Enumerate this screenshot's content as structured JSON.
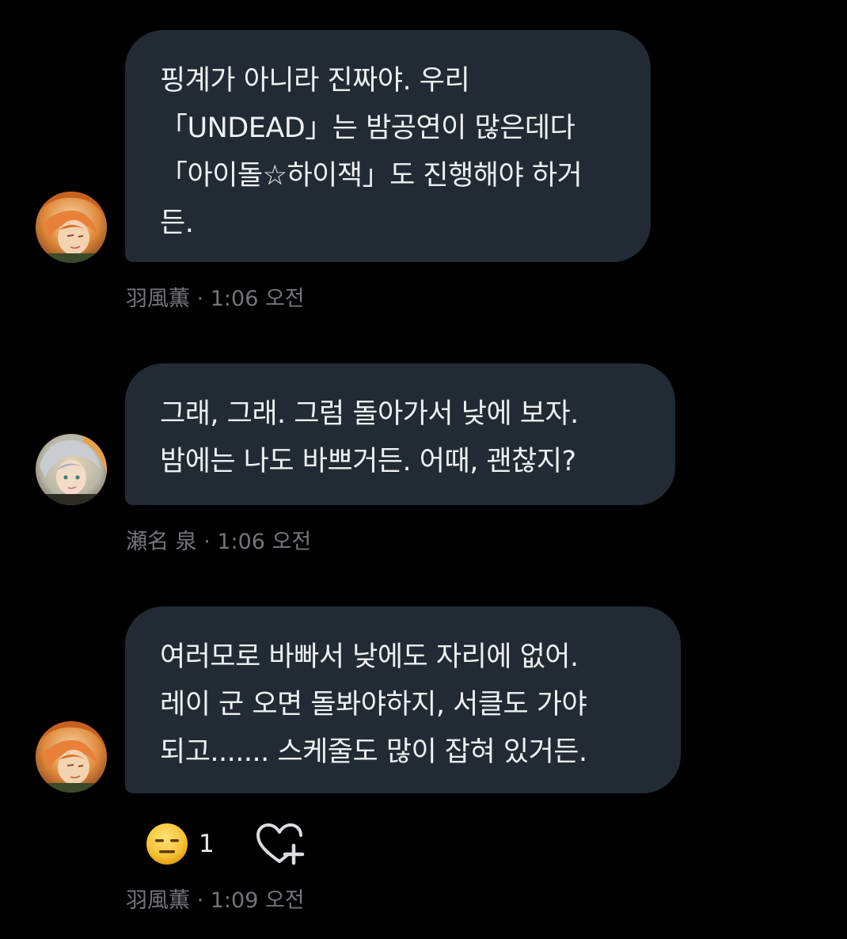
{
  "messages": [
    {
      "sender": "羽風薫",
      "avatar_icon": "orange-hair-avatar-icon",
      "lines": [
        "핑계가 아니라 진짜야. 우리",
        "「UNDEAD」는 밤공연이 많은데다",
        "「아이돌☆하이잭」도 진행해야 하거",
        "든."
      ],
      "time": "1:06 오전"
    },
    {
      "sender": "瀬名 泉",
      "avatar_icon": "silver-hair-avatar-icon",
      "lines": [
        "그래, 그래. 그럼 돌아가서 낮에 보자.",
        "밤에는 나도 바쁘거든. 어때, 괜찮지?"
      ],
      "time": "1:06 오전"
    },
    {
      "sender": "羽風薫",
      "avatar_icon": "orange-hair-avatar-icon",
      "lines": [
        "여러모로 바빠서 낮에도 자리에 없어.",
        "레이 군 오면 돌봐야하지, 서클도 가야",
        "되고....... 스케줄도 많이 잡혀 있거든."
      ],
      "time": "1:09 오전",
      "reactions": [
        {
          "emoji": "expressionless-face-icon",
          "count": "1"
        }
      ],
      "add_reaction_icon": "heart-plus-icon"
    }
  ],
  "separator": " · ",
  "colors": {
    "background": "#000000",
    "bubble": "#222b33",
    "text": "#eef1f3",
    "meta": "#71767b"
  }
}
